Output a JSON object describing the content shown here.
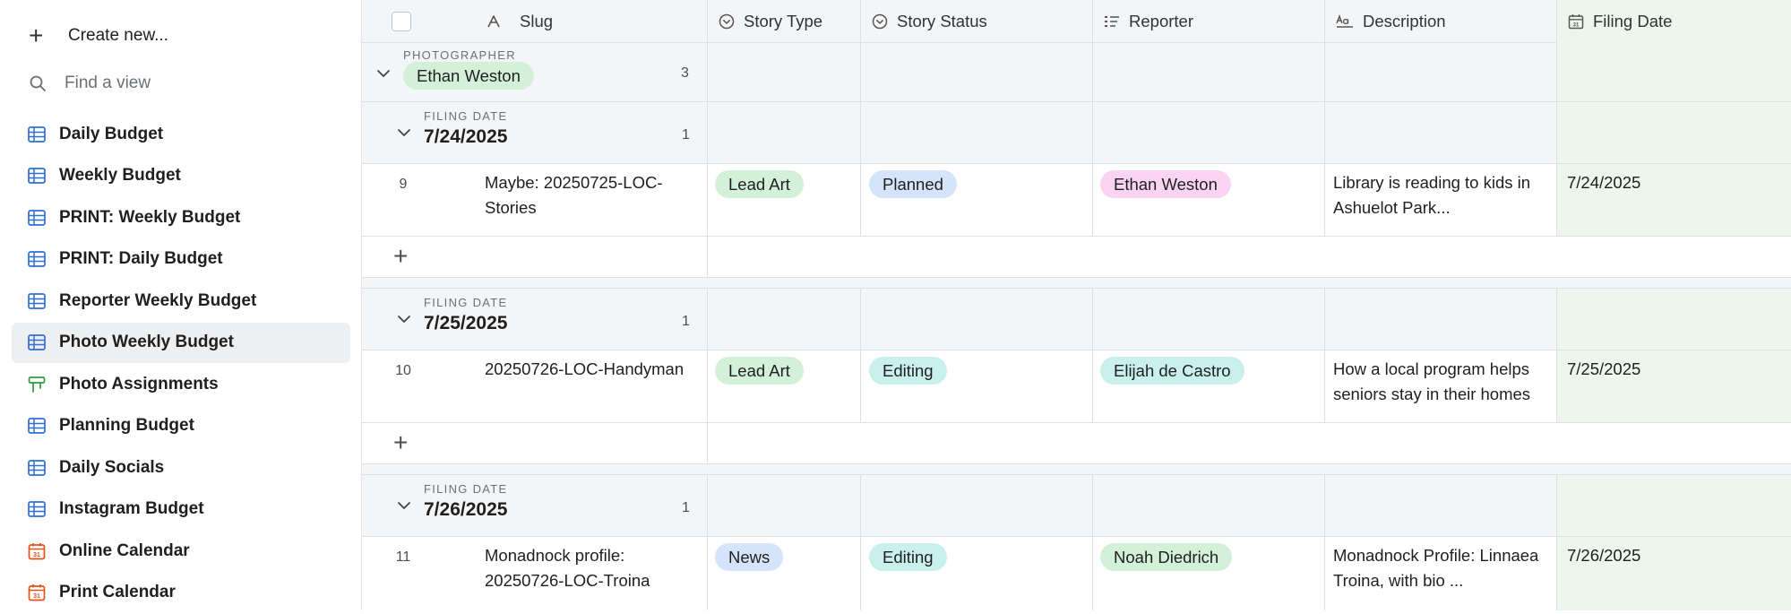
{
  "sidebar": {
    "create_label": "Create new...",
    "find_placeholder": "Find a view",
    "items": [
      {
        "label": "Daily Budget"
      },
      {
        "label": "Weekly Budget"
      },
      {
        "label": "PRINT: Weekly Budget"
      },
      {
        "label": "PRINT: Daily Budget"
      },
      {
        "label": "Reporter Weekly Budget"
      },
      {
        "label": "Photo Weekly Budget",
        "active": true
      },
      {
        "label": "Photo Assignments"
      },
      {
        "label": "Planning Budget"
      },
      {
        "label": "Daily Socials"
      },
      {
        "label": "Instagram Budget"
      },
      {
        "label": "Online Calendar"
      },
      {
        "label": "Print Calendar"
      }
    ]
  },
  "columns": {
    "slug": "Slug",
    "story_type": "Story Type",
    "story_status": "Story Status",
    "reporter": "Reporter",
    "description": "Description",
    "filing_date": "Filing Date"
  },
  "group": {
    "label": "PHOTOGRAPHER",
    "value": "Ethan Weston",
    "count": "3"
  },
  "subgroups": [
    {
      "label": "FILING DATE",
      "value": "7/24/2025",
      "count": "1",
      "record": {
        "num": "9",
        "slug": "Maybe: 20250725-LOC-Stories",
        "story_type": "Lead Art",
        "story_status": "Planned",
        "reporter": "Ethan Weston",
        "description": "Library is reading to kids in Ashuelot Park...",
        "filing_date": "7/24/2025"
      }
    },
    {
      "label": "FILING DATE",
      "value": "7/25/2025",
      "count": "1",
      "record": {
        "num": "10",
        "slug": "20250726-LOC-Handyman",
        "story_type": "Lead Art",
        "story_status": "Editing",
        "reporter": "Elijah de Castro",
        "description": "How a local program helps seniors stay in their homes",
        "filing_date": "7/25/2025"
      }
    },
    {
      "label": "FILING DATE",
      "value": "7/26/2025",
      "count": "1",
      "record": {
        "num": "11",
        "slug": "Monadnock profile: 20250726-LOC-Troina",
        "story_type": "News",
        "story_status": "Editing",
        "reporter": "Noah Diedrich",
        "description": "Monadnock Profile: Linnaea Troina, with bio ...",
        "filing_date": "7/26/2025"
      }
    }
  ],
  "colors": {
    "pill_green": "#d3f0d8",
    "pill_blue": "#d6e4fb",
    "pill_teal": "#c9f0ec",
    "pill_pink": "#fbd4f3",
    "filing_date_bg": "#ecf6ec",
    "accent_blue": "#2f6fd6",
    "accent_green": "#2e9b3b",
    "accent_orange": "#e2541c"
  },
  "add_record_symbol": "+"
}
